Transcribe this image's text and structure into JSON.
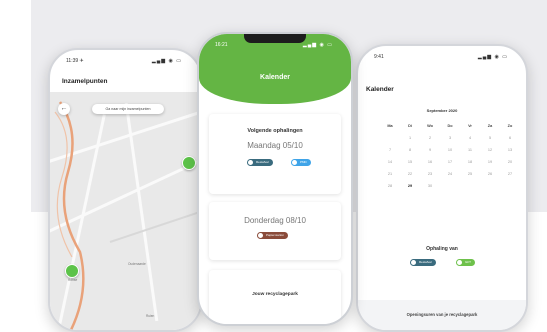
{
  "colors": {
    "brand_green": "#64b544",
    "pin_green": "#5dc34a",
    "chip_dark": "#3a6b7e",
    "chip_blue": "#3fa4e8",
    "chip_brown": "#8a4b3a",
    "chip_green": "#6ec14b"
  },
  "left_phone": {
    "time": "11:39 ✈",
    "signal": "▂▄▆ ◉ ▭",
    "title": "Inzamelpunten",
    "search_text": "Ga naar mijn inzamelpunten",
    "back_icon": "←",
    "labels": [
      "Ronse",
      "Oudenaarde",
      "Ruien"
    ]
  },
  "center_phone": {
    "time": "16:21",
    "signal": "▂▄▆ ◉ ▭",
    "header_title": "Kalender",
    "card1_title": "Volgende ophalingen",
    "card1_date": "Maandag 05/10",
    "card1_chip1": "Restafval",
    "card1_chip2": "PMD",
    "card2_date": "Donderdag 08/10",
    "card2_chip1": "Papier-karton",
    "card3_title": "Jouw recyclagepark"
  },
  "right_phone": {
    "time": "9:41",
    "signal": "▂▄▆ ◉ ▭",
    "title": "Kalender",
    "month": "September 2020",
    "weekdays": [
      "Ma",
      "Di",
      "Wo",
      "Do",
      "Vr",
      "Za",
      "Zo"
    ],
    "weeks": [
      [
        "",
        "1",
        "2",
        "3",
        "4",
        "5",
        "6"
      ],
      [
        "7",
        "8",
        "9",
        "10",
        "11",
        "12",
        "13"
      ],
      [
        "14",
        "15",
        "16",
        "17",
        "18",
        "19",
        "20"
      ],
      [
        "21",
        "22",
        "23",
        "24",
        "25",
        "26",
        "27"
      ],
      [
        "28",
        "29",
        "30",
        "",
        "",
        "",
        ""
      ]
    ],
    "subtitle": "Ophaling van",
    "chip1": "Restafval",
    "chip2": "GFT",
    "footer": "Openingsuren van je recyclagepark"
  }
}
